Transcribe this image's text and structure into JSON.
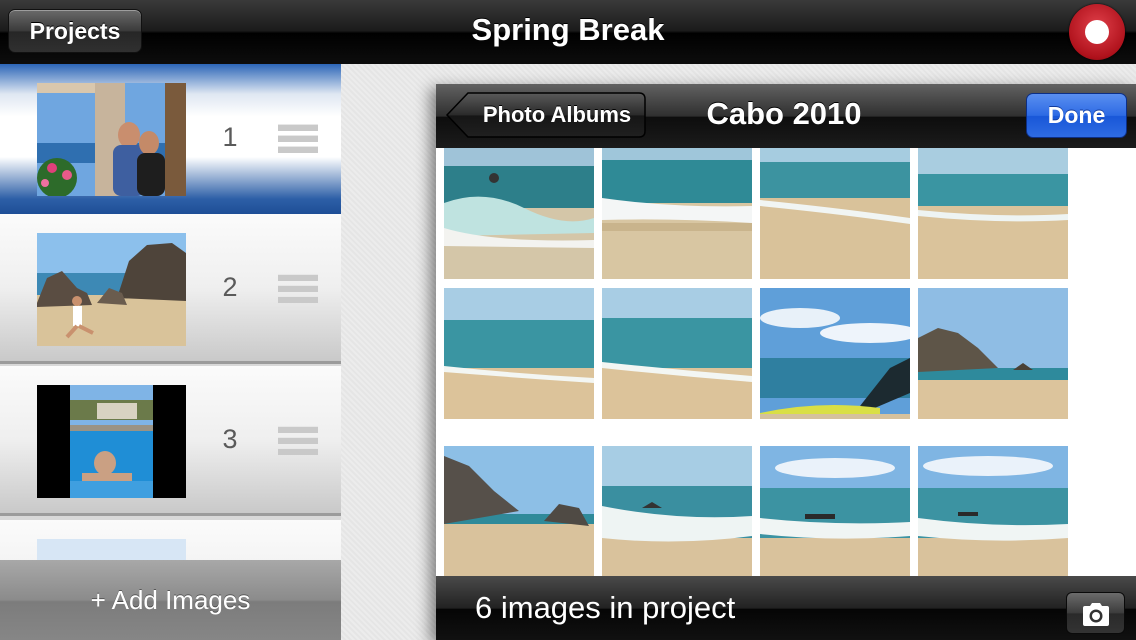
{
  "topbar": {
    "projects_label": "Projects",
    "title": "Spring Break",
    "record_icon": "record-icon"
  },
  "sidebar": {
    "items": [
      {
        "number": "1",
        "scene": "couple-balcony"
      },
      {
        "number": "2",
        "scene": "beach-rocks-jump"
      },
      {
        "number": "3",
        "scene": "pool-swimmer"
      }
    ],
    "add_label": "+ Add Images"
  },
  "picker": {
    "back_label": "Photo Albums",
    "album_title": "Cabo 2010",
    "done_label": "Done",
    "photos": [
      "wave-surf",
      "wave-shore",
      "sandy-beach",
      "beach-horizon",
      "calm-beach",
      "shoreline",
      "boat-sky",
      "cliff-beach",
      "rocky-cliff",
      "surf-rocks",
      "cloudy-sea",
      "cloudy-surf"
    ],
    "status": "6 images in project",
    "camera_icon": "camera-icon"
  },
  "colors": {
    "accent_blue": "#2d6ae4",
    "record_red": "#c0141f",
    "selection_blue": "#1e4e96"
  }
}
